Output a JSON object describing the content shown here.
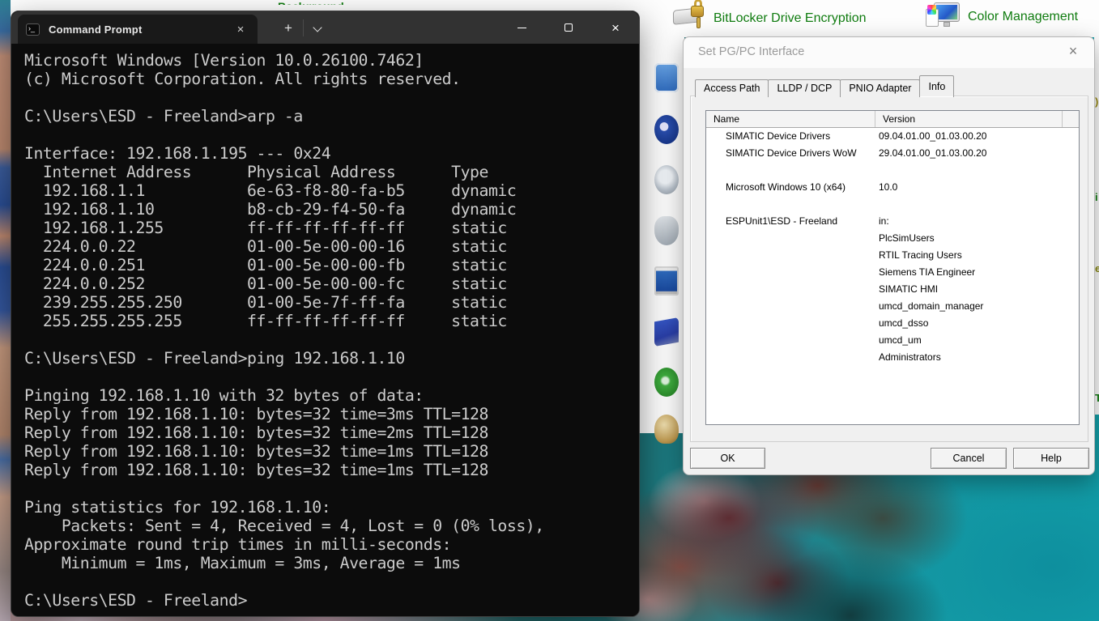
{
  "colors": {
    "cp_link_green": "#107c10",
    "terminal_bg": "#0c0c0c",
    "terminal_text": "#cccccc",
    "dialog_bg": "#f0f0f0"
  },
  "terminal": {
    "tab_title": "Command Prompt",
    "tab_close_glyph": "×",
    "new_tab_glyph": "+",
    "close_glyph": "×",
    "lines": [
      "Microsoft Windows [Version 10.0.26100.7462]",
      "(c) Microsoft Corporation. All rights reserved.",
      "",
      "C:\\Users\\ESD - Freeland>arp -a",
      "",
      "Interface: 192.168.1.195 --- 0x24",
      "  Internet Address      Physical Address      Type",
      "  192.168.1.1           6e-63-f8-80-fa-b5     dynamic",
      "  192.168.1.10          b8-cb-29-f4-50-fa     dynamic",
      "  192.168.1.255         ff-ff-ff-ff-ff-ff     static",
      "  224.0.0.22            01-00-5e-00-00-16     static",
      "  224.0.0.251           01-00-5e-00-00-fb     static",
      "  224.0.0.252           01-00-5e-00-00-fc     static",
      "  239.255.255.250       01-00-5e-7f-ff-fa     static",
      "  255.255.255.255       ff-ff-ff-ff-ff-ff     static",
      "",
      "C:\\Users\\ESD - Freeland>ping 192.168.1.10",
      "",
      "Pinging 192.168.1.10 with 32 bytes of data:",
      "Reply from 192.168.1.10: bytes=32 time=3ms TTL=128",
      "Reply from 192.168.1.10: bytes=32 time=2ms TTL=128",
      "Reply from 192.168.1.10: bytes=32 time=1ms TTL=128",
      "Reply from 192.168.1.10: bytes=32 time=1ms TTL=128",
      "",
      "Ping statistics for 192.168.1.10:",
      "    Packets: Sent = 4, Received = 4, Lost = 0 (0% loss),",
      "Approximate round trip times in milli-seconds:",
      "    Minimum = 1ms, Maximum = 3ms, Average = 1ms",
      "",
      "C:\\Users\\ESD - Freeland>"
    ]
  },
  "dialog": {
    "title": "Set PG/PC Interface",
    "close_glyph": "×",
    "tabs": [
      {
        "label": "Access Path",
        "active": false
      },
      {
        "label": "LLDP / DCP",
        "active": false
      },
      {
        "label": "PNIO Adapter",
        "active": false
      },
      {
        "label": "Info",
        "active": true
      }
    ],
    "list": {
      "columns": [
        "Name",
        "Version"
      ],
      "rows": [
        {
          "name": "SIMATIC Device Drivers",
          "version": "09.04.01.00_01.03.00.20"
        },
        {
          "name": "SIMATIC Device Drivers WoW",
          "version": "29.04.01.00_01.03.00.20"
        },
        {
          "name": "",
          "version": ""
        },
        {
          "name": "Microsoft Windows 10 (x64)",
          "version": "10.0"
        },
        {
          "name": "",
          "version": ""
        },
        {
          "name": "ESPUnit1\\ESD - Freeland",
          "version": "in:"
        },
        {
          "name": "",
          "version": "PlcSimUsers"
        },
        {
          "name": "",
          "version": "RTIL Tracing Users"
        },
        {
          "name": "",
          "version": "Siemens TIA Engineer"
        },
        {
          "name": "",
          "version": "SIMATIC HMI"
        },
        {
          "name": "",
          "version": "umcd_domain_manager"
        },
        {
          "name": "",
          "version": "umcd_dsso"
        },
        {
          "name": "",
          "version": "umcd_um"
        },
        {
          "name": "",
          "version": "Administrators"
        }
      ]
    },
    "buttons": {
      "ok": "OK",
      "cancel": "Cancel",
      "help": "Help"
    }
  },
  "control_panel": {
    "items": [
      {
        "label": "BitLocker Drive Encryption"
      },
      {
        "label": "Color Management"
      }
    ],
    "edge_fragments": [
      ")",
      "i",
      "e",
      "Te"
    ]
  }
}
